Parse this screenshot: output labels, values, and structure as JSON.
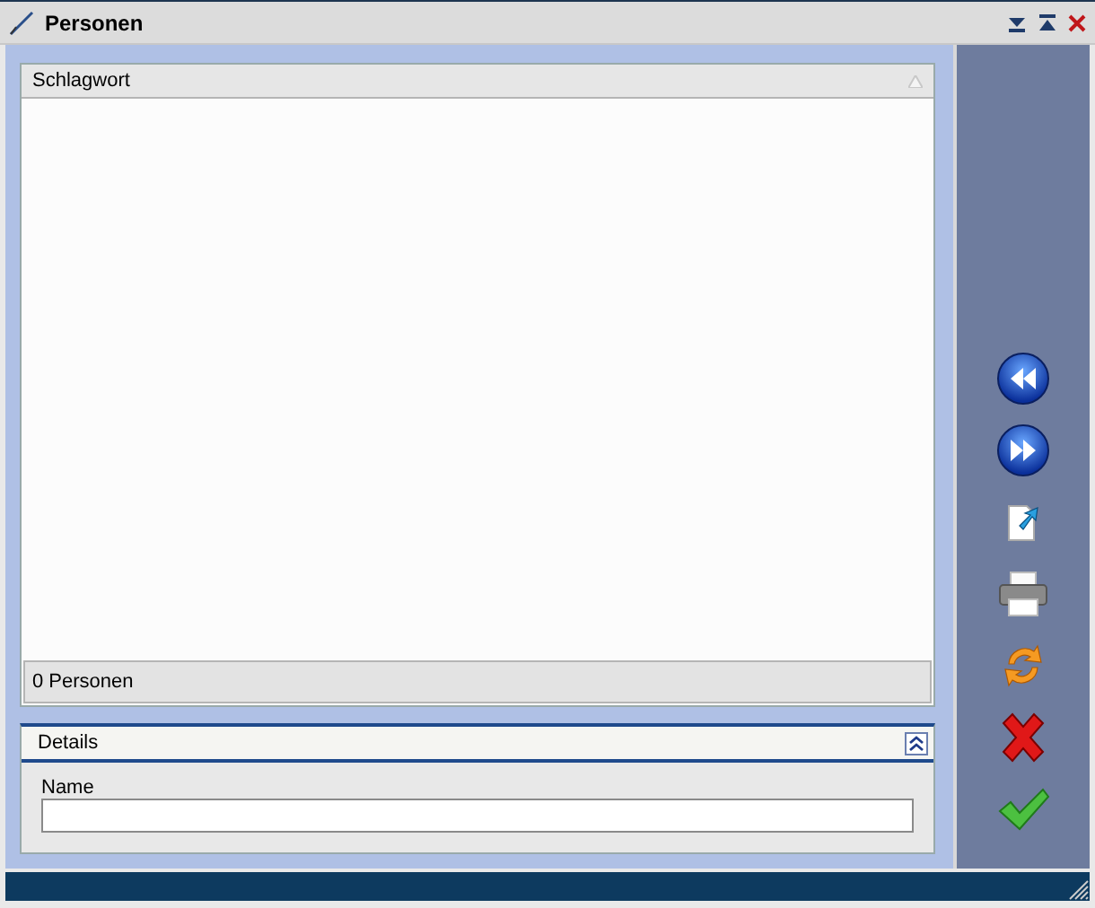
{
  "window": {
    "title": "Personen"
  },
  "grid": {
    "columns": [
      {
        "label": "Schlagwort"
      }
    ],
    "footer": "0 Personen"
  },
  "details": {
    "title": "Details",
    "expanded": true,
    "fields": [
      {
        "label": "Name"
      }
    ]
  }
}
